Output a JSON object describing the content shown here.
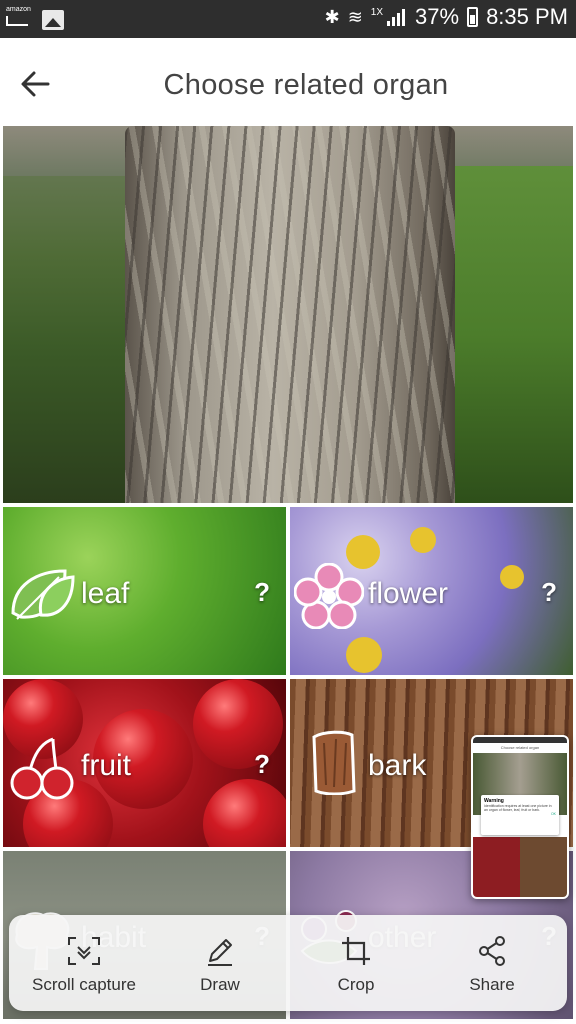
{
  "status_bar": {
    "amazon_text": "amazon",
    "signal_label": "1X",
    "battery": "37%",
    "time": "8:35 PM"
  },
  "header": {
    "title": "Choose related organ"
  },
  "organs": [
    {
      "label": "leaf",
      "help": "?"
    },
    {
      "label": "flower",
      "help": "?"
    },
    {
      "label": "fruit",
      "help": "?"
    },
    {
      "label": "bark",
      "help": "?"
    },
    {
      "label": "habit",
      "help": "?"
    },
    {
      "label": "other",
      "help": "?"
    }
  ],
  "preview": {
    "title": "Choose related organ",
    "dialog_title": "Warning",
    "dialog_text": "Identification requires at least one picture in an organ of flower, leaf, fruit or bark.",
    "dialog_ok": "OK"
  },
  "toolbar": {
    "scroll_capture": "Scroll capture",
    "draw": "Draw",
    "crop": "Crop",
    "share": "Share"
  }
}
